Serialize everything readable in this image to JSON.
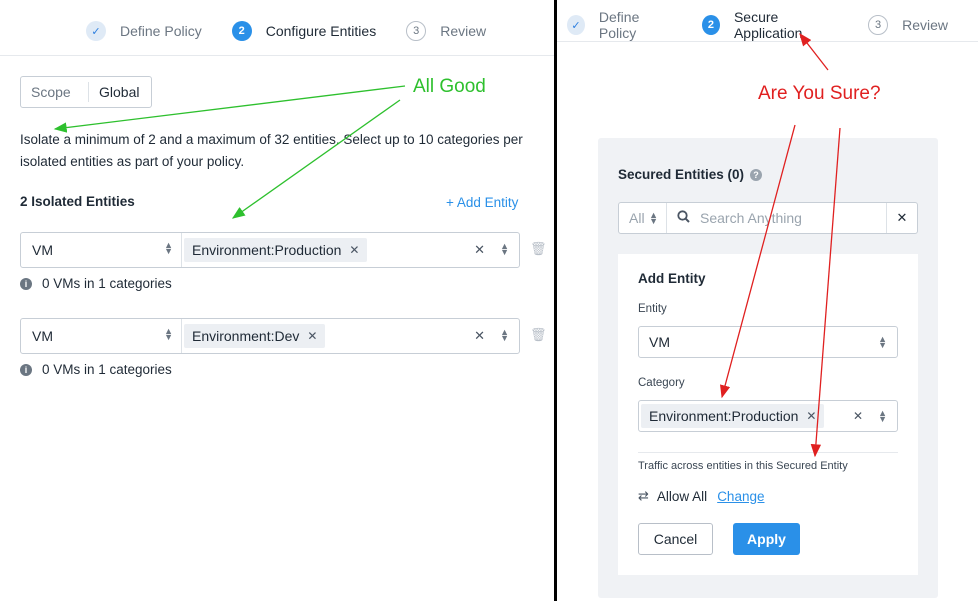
{
  "left": {
    "steps": [
      {
        "number": "✓",
        "label": "Define Policy",
        "state": "done"
      },
      {
        "number": "2",
        "label": "Configure Entities",
        "state": "active"
      },
      {
        "number": "3",
        "label": "Review",
        "state": "todo"
      }
    ],
    "scope": {
      "label": "Scope",
      "value": "Global"
    },
    "description": "Isolate a minimum of 2 and a maximum of 32 entities. Select up to 10 categories per isolated entities as part of your policy.",
    "isolated_title": "2 Isolated Entities",
    "add_entity": "+ Add Entity",
    "rows": [
      {
        "type": "VM",
        "tag": "Environment:Production",
        "info": "0 VMs in 1 categories"
      },
      {
        "type": "VM",
        "tag": "Environment:Dev",
        "info": "0 VMs in 1 categories"
      }
    ],
    "annotation": "All Good"
  },
  "right": {
    "steps": [
      {
        "number": "✓",
        "label": "Define Policy",
        "state": "done"
      },
      {
        "number": "2",
        "label": "Secure Application",
        "state": "active"
      },
      {
        "number": "3",
        "label": "Review",
        "state": "todo"
      }
    ],
    "annotation": "Are You Sure?",
    "secured_title": "Secured Entities (0)",
    "search": {
      "scope": "All",
      "placeholder": "Search Anything"
    },
    "add_entity_card": {
      "title": "Add Entity",
      "entity_label": "Entity",
      "entity_value": "VM",
      "category_label": "Category",
      "category_tag": "Environment:Production",
      "traffic_label": "Traffic across entities in this Secured Entity",
      "allow_all": "Allow All",
      "change": "Change",
      "cancel": "Cancel",
      "apply": "Apply"
    }
  },
  "colors": {
    "accent": "#2a90e8",
    "annotation_green": "#2ec02e",
    "annotation_red": "#e02020"
  }
}
